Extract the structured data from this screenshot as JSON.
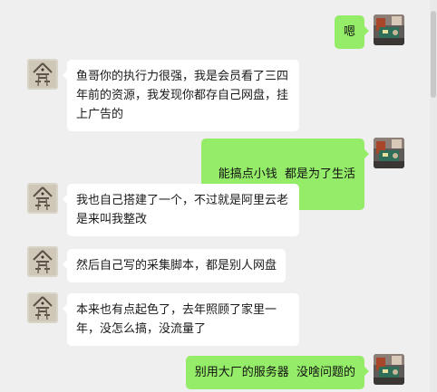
{
  "chat": {
    "messages": [
      {
        "side": "out",
        "text": "嗯"
      },
      {
        "side": "in",
        "text": "鱼哥你的执行力很强，我是会员看了三四年前的资源，我发现你都存自己网盘，挂上广告的"
      },
      {
        "side": "out",
        "text": "能搞点小钱  都是为了生活",
        "emoji": "laugh-emoji"
      },
      {
        "side": "in",
        "text": "我也自己搭建了一个，不过就是阿里云老是来叫我整改"
      },
      {
        "side": "in",
        "text": "然后自己写的采集脚本，都是别人网盘"
      },
      {
        "side": "in",
        "text": "本来也有点起色了，去年照顾了家里一年，没怎么搞，没流量了"
      },
      {
        "side": "out",
        "text": "别用大厂的服务器  没啥问题的"
      }
    ]
  },
  "colors": {
    "background": "#efefef",
    "outgoing_bubble": "#95ec69",
    "incoming_bubble": "#ffffff"
  }
}
